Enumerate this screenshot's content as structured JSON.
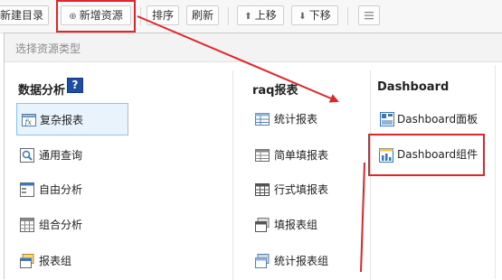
{
  "toolbar": {
    "new_folder": "新建目录",
    "new_resource": "新增资源",
    "new_resource_icon": "plus-circle-icon",
    "sort": "排序",
    "refresh": "刷新",
    "move_up": "上移",
    "move_down": "下移",
    "more_icon": "list-menu-icon"
  },
  "panel": {
    "title": "选择资源类型",
    "columns": [
      {
        "header": "数据分析",
        "items": [
          {
            "label": "复杂报表",
            "icon": "fx-report-icon",
            "selected": true
          },
          {
            "label": "通用查询",
            "icon": "search-list-icon"
          },
          {
            "label": "自由分析",
            "icon": "free-analysis-icon"
          },
          {
            "label": "组合分析",
            "icon": "grid-icon"
          },
          {
            "label": "报表组",
            "icon": "report-group-icon"
          }
        ]
      },
      {
        "header": "raq报表",
        "items": [
          {
            "label": "统计报表",
            "icon": "table-icon"
          },
          {
            "label": "简单填报表",
            "icon": "form-table-icon"
          },
          {
            "label": "行式填报表",
            "icon": "row-table-icon"
          },
          {
            "label": "填报表组",
            "icon": "fill-group-icon"
          },
          {
            "label": "统计报表组",
            "icon": "stat-group-icon"
          }
        ]
      },
      {
        "header": "Dashboard",
        "items": [
          {
            "label": "Dashboard面板",
            "icon": "dashboard-panel-icon"
          },
          {
            "label": "Dashboard组件",
            "icon": "bar-chart-icon",
            "highlighted": true
          }
        ]
      }
    ]
  },
  "colors": {
    "highlight": "#e0262b",
    "selected_bg": "#e9f3fc",
    "selected_border": "#8ec3ec",
    "icon_blue": "#3c78b9",
    "help_bg": "#1f4ea1"
  }
}
